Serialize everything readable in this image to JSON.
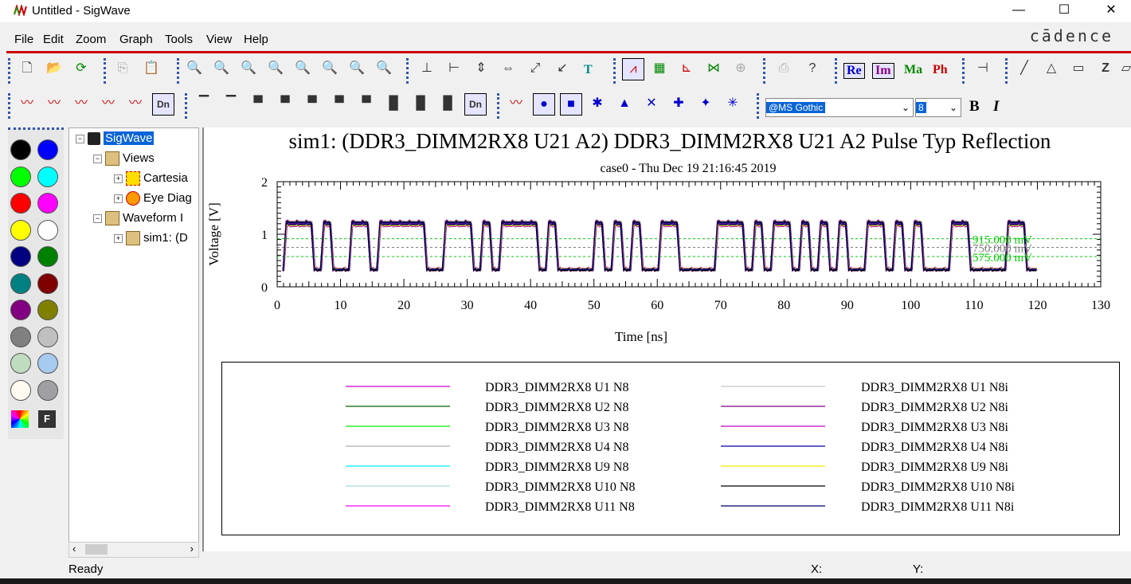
{
  "window": {
    "title": "Untitled - SigWave",
    "minimize": "—",
    "maximize": "☐",
    "close": "✕"
  },
  "menu": [
    "File",
    "Edit",
    "Zoom",
    "Graph",
    "Tools",
    "View",
    "Help"
  ],
  "brand": "cādence",
  "toolbar": {
    "re_label": "Re",
    "im_label": "Im",
    "ma_label": "Ma",
    "ph_label": "Ph",
    "font_name": "@MS Gothic",
    "font_size": "8",
    "bold": "B",
    "italic": "I",
    "t_label": "T",
    "tt_label": "T"
  },
  "palette": {
    "colors": [
      "#000000",
      "#0000ff",
      "#00ff00",
      "#00ffff",
      "#ff0000",
      "#ff00ff",
      "#ffff00",
      "#ffffff",
      "#000080",
      "#008000",
      "#008080",
      "#800000",
      "#800080",
      "#808000",
      "#808080",
      "#c0c0c0",
      "#c0dcc0",
      "#a6caf0",
      "#fffbf0",
      "#a0a0a4"
    ]
  },
  "tree": {
    "root": "SigWave",
    "views": "Views",
    "cartesian": "Cartesia",
    "eye": "Eye Diag",
    "waveform": "Waveform I",
    "sim": "sim1: (D"
  },
  "chart_data": {
    "type": "line",
    "title": "sim1: (DDR3_DIMM2RX8 U21 A2) DDR3_DIMM2RX8 U21 A2 Pulse Typ Reflection",
    "subtitle": "case0 - Thu Dec 19 21:16:45 2019",
    "xlabel": "Time [ns]",
    "ylabel": "Voltage [V]",
    "xlim": [
      0,
      130
    ],
    "ylim": [
      0,
      2
    ],
    "xticks": [
      0,
      10,
      20,
      30,
      40,
      50,
      60,
      70,
      80,
      90,
      100,
      110,
      120,
      130
    ],
    "yticks": [
      0,
      1,
      2
    ],
    "grid": false,
    "reference_levels": [
      {
        "label": "915.000 mV",
        "value": 0.915,
        "color": "#00cc00"
      },
      {
        "label": "750.000 mV",
        "value": 0.75,
        "color": "#808080"
      },
      {
        "label": "575.000 mV",
        "value": 0.575,
        "color": "#00cc00"
      }
    ],
    "high_level": 1.25,
    "low_level": 0.3,
    "bit_pattern": [
      1,
      1,
      1,
      0,
      1,
      0,
      0,
      1,
      1,
      0,
      1,
      1,
      1,
      1,
      1,
      0,
      0,
      1,
      1,
      1,
      0,
      1,
      0,
      1,
      1,
      1,
      1,
      0,
      1,
      0,
      0,
      0,
      0,
      1,
      0,
      1,
      0,
      1,
      0,
      0,
      1,
      1,
      0,
      0,
      0,
      0,
      1,
      1,
      1,
      0,
      1,
      0,
      1,
      1,
      0,
      1,
      0,
      1,
      0,
      1,
      0,
      0,
      1,
      1,
      0,
      1,
      0,
      1,
      0,
      0,
      0,
      1,
      1,
      0,
      0,
      0,
      0,
      1,
      1,
      0,
      0
    ],
    "bit_period_ns": 1.48,
    "start_ns": 1,
    "end_ns": 120,
    "series_left": [
      {
        "name": "DDR3_DIMM2RX8 U1 N8",
        "color": "#cc00cc"
      },
      {
        "name": "DDR3_DIMM2RX8 U2 N8",
        "color": "#006600"
      },
      {
        "name": "DDR3_DIMM2RX8 U3 N8",
        "color": "#00ee00"
      },
      {
        "name": "DDR3_DIMM2RX8 U4 N8",
        "color": "#b0b0b0"
      },
      {
        "name": "DDR3_DIMM2RX8 U9 N8",
        "color": "#00eeee"
      },
      {
        "name": "DDR3_DIMM2RX8 U10 N8",
        "color": "#aadddd"
      },
      {
        "name": "DDR3_DIMM2RX8 U11 N8",
        "color": "#ff00ff"
      }
    ],
    "series_right": [
      {
        "name": "DDR3_DIMM2RX8 U1 N8i",
        "color": "#c8c8c8"
      },
      {
        "name": "DDR3_DIMM2RX8 U2 N8i",
        "color": "#800080"
      },
      {
        "name": "DDR3_DIMM2RX8 U3 N8i",
        "color": "#cc00cc"
      },
      {
        "name": "DDR3_DIMM2RX8 U4 N8i",
        "color": "#0000aa"
      },
      {
        "name": "DDR3_DIMM2RX8 U9 N8i",
        "color": "#eeee00"
      },
      {
        "name": "DDR3_DIMM2RX8 U10 N8i",
        "color": "#000000"
      },
      {
        "name": "DDR3_DIMM2RX8 U11 N8i",
        "color": "#000066"
      }
    ]
  },
  "status": {
    "ready": "Ready",
    "x_label": "X:",
    "y_label": "Y:"
  }
}
